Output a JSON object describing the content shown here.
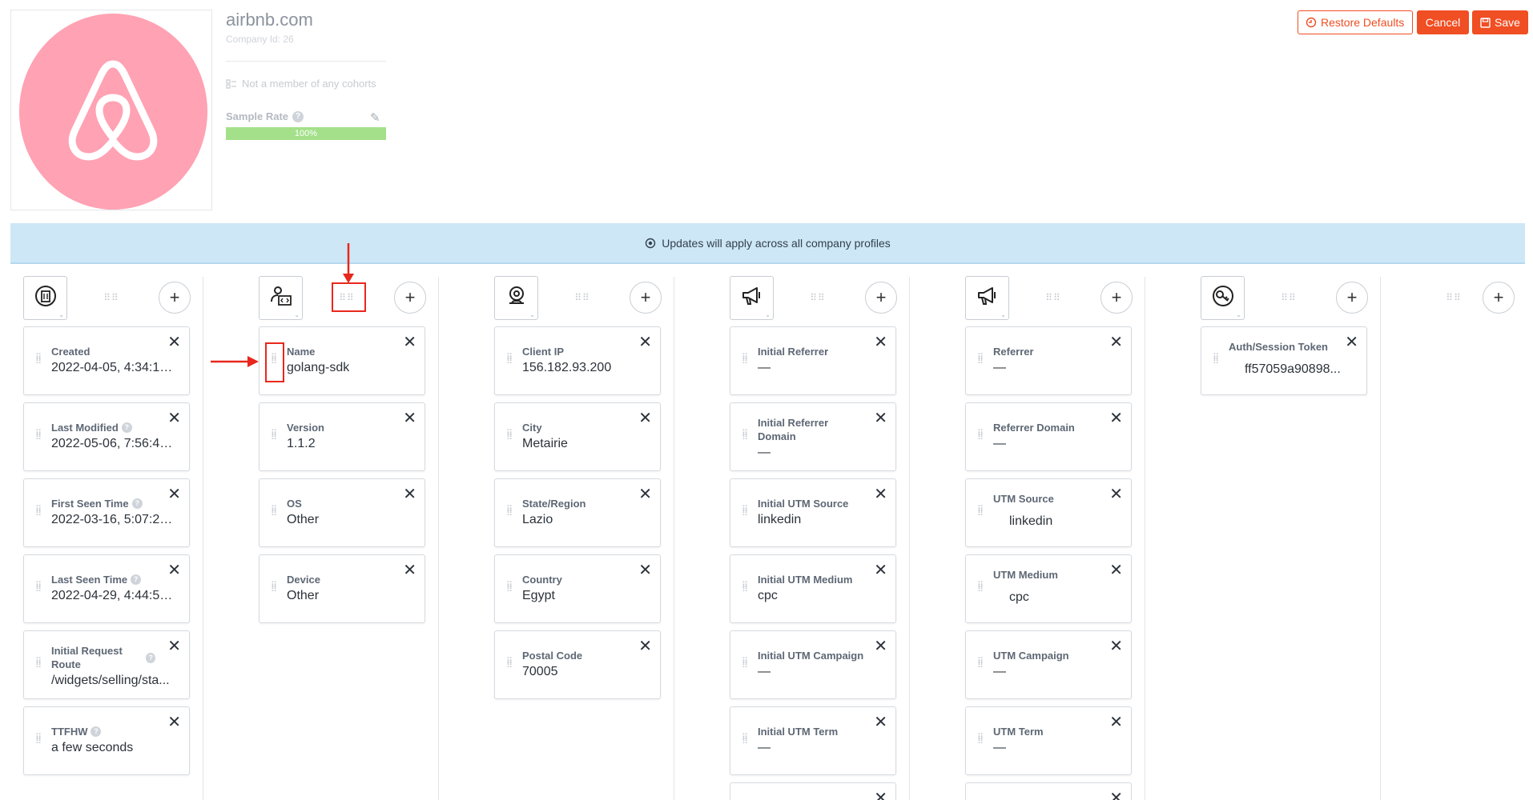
{
  "company": {
    "name": "airbnb.com",
    "id_label": "Company Id: 26",
    "cohorts_text": "Not a member of any cohorts",
    "sample_rate_label": "Sample Rate",
    "sample_rate_value": "100%",
    "sample_rate_fraction": 1.0,
    "logo_color": "#ffa2b3"
  },
  "actions": {
    "restore_label": "Restore Defaults",
    "cancel_label": "Cancel",
    "save_label": "Save",
    "accent_color": "#f04e23"
  },
  "banner": {
    "text": "Updates will apply across all company profiles"
  },
  "columns": [
    {
      "icon": "building-globe-icon",
      "fields": [
        {
          "label": "Created",
          "value": "2022-04-05, 4:34:19 ...",
          "help": false
        },
        {
          "label": "Last Modified",
          "value": "2022-05-06, 7:56:46 ...",
          "help": true
        },
        {
          "label": "First Seen Time",
          "value": "2022-03-16, 5:07:27 ...",
          "help": true
        },
        {
          "label": "Last Seen Time",
          "value": "2022-04-29, 4:44:55 ...",
          "help": true
        },
        {
          "label": "Initial Request Route",
          "value": "/widgets/selling/sta...",
          "help": true
        },
        {
          "label": "TTFHW",
          "value": "a few seconds",
          "help": true
        }
      ]
    },
    {
      "icon": "user-code-icon",
      "fields": [
        {
          "label": "Name",
          "value": "golang-sdk"
        },
        {
          "label": "Version",
          "value": "1.1.2"
        },
        {
          "label": "OS",
          "value": "Other"
        },
        {
          "label": "Device",
          "value": "Other"
        }
      ]
    },
    {
      "icon": "location-pin-icon",
      "fields": [
        {
          "label": "Client IP",
          "value": "156.182.93.200"
        },
        {
          "label": "City",
          "value": "Metairie"
        },
        {
          "label": "State/Region",
          "value": "Lazio"
        },
        {
          "label": "Country",
          "value": "Egypt"
        },
        {
          "label": "Postal Code",
          "value": "70005"
        }
      ]
    },
    {
      "icon": "megaphone-icon",
      "fields": [
        {
          "label": "Initial Referrer",
          "value": "—"
        },
        {
          "label": "Initial Referrer Domain",
          "value": "—"
        },
        {
          "label": "Initial UTM Source",
          "value": "linkedin"
        },
        {
          "label": "Initial UTM Medium",
          "value": "cpc"
        },
        {
          "label": "Initial UTM Campaign",
          "value": "—"
        },
        {
          "label": "Initial UTM Term",
          "value": "—"
        }
      ]
    },
    {
      "icon": "megaphone-icon",
      "fields": [
        {
          "label": "Referrer",
          "value": "—"
        },
        {
          "label": "Referrer Domain",
          "value": "—"
        },
        {
          "label": "UTM Source",
          "value": "linkedin"
        },
        {
          "label": "UTM Medium",
          "value": "cpc"
        },
        {
          "label": "UTM Campaign",
          "value": "—"
        },
        {
          "label": "UTM Term",
          "value": "—"
        }
      ]
    },
    {
      "icon": "key-icon",
      "fields": [
        {
          "label": "Auth/Session Token",
          "value": "ff57059a90898..."
        }
      ]
    }
  ]
}
